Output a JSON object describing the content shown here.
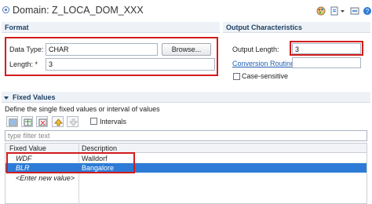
{
  "title": "Domain: Z_LOCA_DOM_XXX",
  "format": {
    "header": "Format",
    "data_type_label": "Data Type: *",
    "data_type_value": "CHAR",
    "browse_label": "Browse...",
    "length_label": "Length: *",
    "length_value": "3"
  },
  "output": {
    "header": "Output Characteristics",
    "output_length_label": "Output Length:",
    "output_length_value": "3",
    "conversion_routine_label": "Conversion Routine:",
    "conversion_routine_value": "",
    "case_sensitive_label": "Case-sensitive"
  },
  "fixed_values": {
    "header": "Fixed Values",
    "description": "Define the single fixed values or interval of values",
    "intervals_label": "Intervals",
    "filter_placeholder": "type filter text",
    "columns": [
      "Fixed Value",
      "Description"
    ],
    "rows": [
      {
        "value": "WDF",
        "description": "Walldorf"
      },
      {
        "value": "BLR",
        "description": "Bangalore"
      }
    ],
    "new_value_placeholder": "<Enter new value>"
  },
  "colors": {
    "accent": "#1e4164",
    "selection": "#2d7bd6",
    "highlight": "#d31c1c"
  }
}
